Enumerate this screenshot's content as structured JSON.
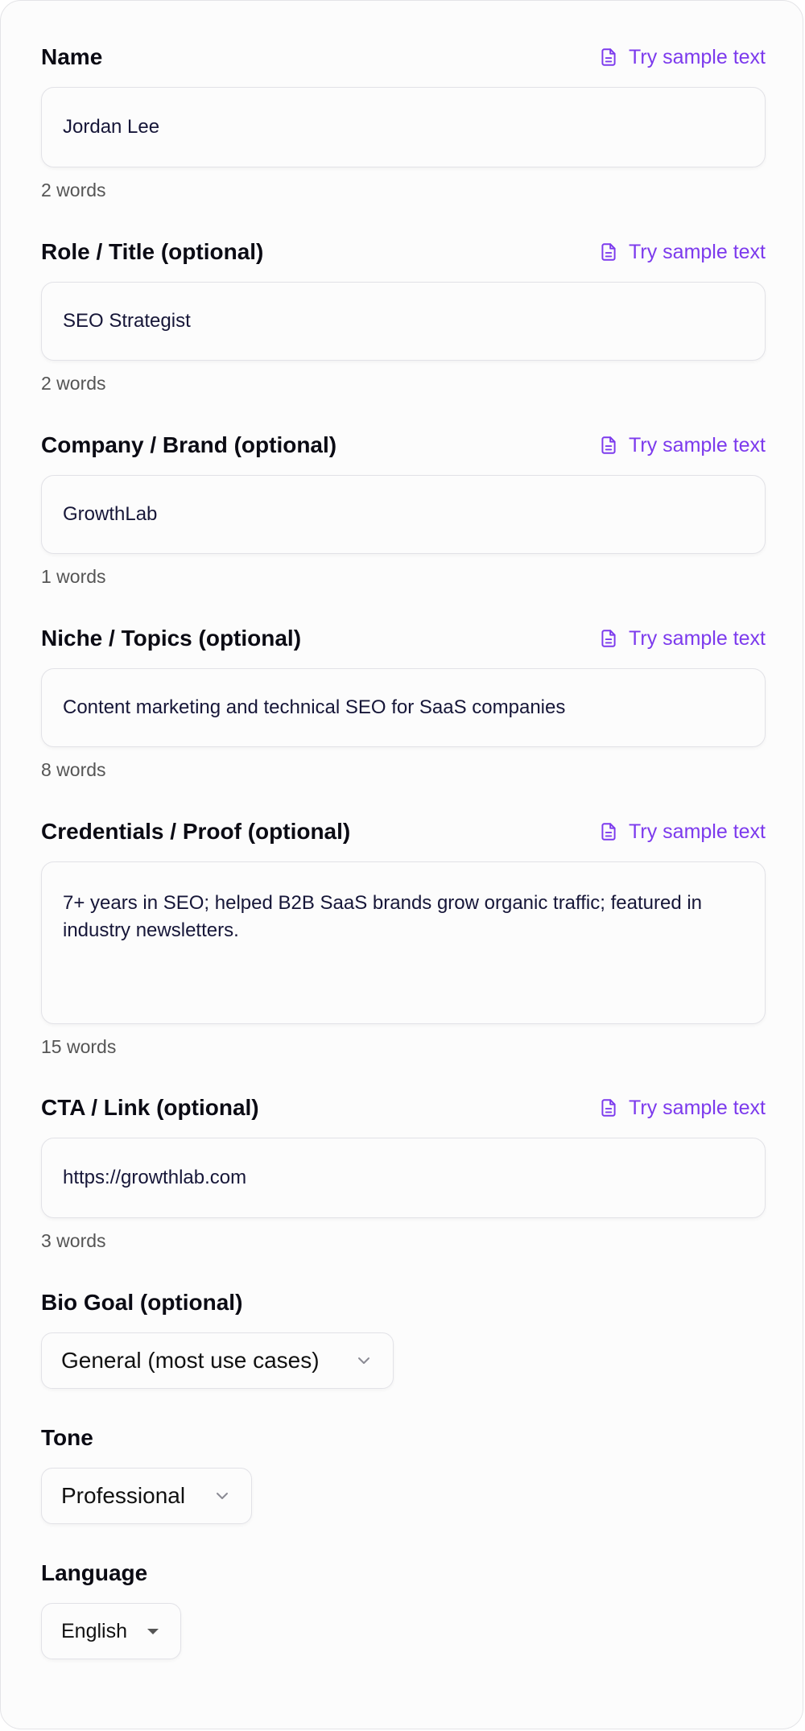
{
  "sample_label": "Try sample text",
  "fields": [
    {
      "label": "Name",
      "value": "Jordan Lee",
      "count": "2 words"
    },
    {
      "label": "Role / Title (optional)",
      "value": "SEO Strategist",
      "count": "2 words"
    },
    {
      "label": "Company / Brand (optional)",
      "value": "GrowthLab",
      "count": "1 words"
    },
    {
      "label": "Niche / Topics (optional)",
      "value": "Content marketing and technical SEO for SaaS companies",
      "count": "8 words"
    },
    {
      "label": "Credentials / Proof (optional)",
      "value": "7+ years in SEO; helped B2B SaaS brands grow organic traffic; featured in industry newsletters.",
      "count": "15 words"
    },
    {
      "label": "CTA / Link (optional)",
      "value": "https://growthlab.com",
      "count": "3 words"
    }
  ],
  "bio_goal": {
    "label": "Bio Goal (optional)",
    "selected": "General (most use cases)"
  },
  "tone": {
    "label": "Tone",
    "selected": "Professional"
  },
  "language": {
    "label": "Language",
    "selected": "English"
  },
  "colors": {
    "accent": "#7c3aed",
    "border": "#e2e2e7",
    "muted_text": "#555555"
  },
  "icons": {
    "sample": "document-icon",
    "dropdown": "chevron-down-icon",
    "language_dropdown": "caret-down-icon"
  }
}
